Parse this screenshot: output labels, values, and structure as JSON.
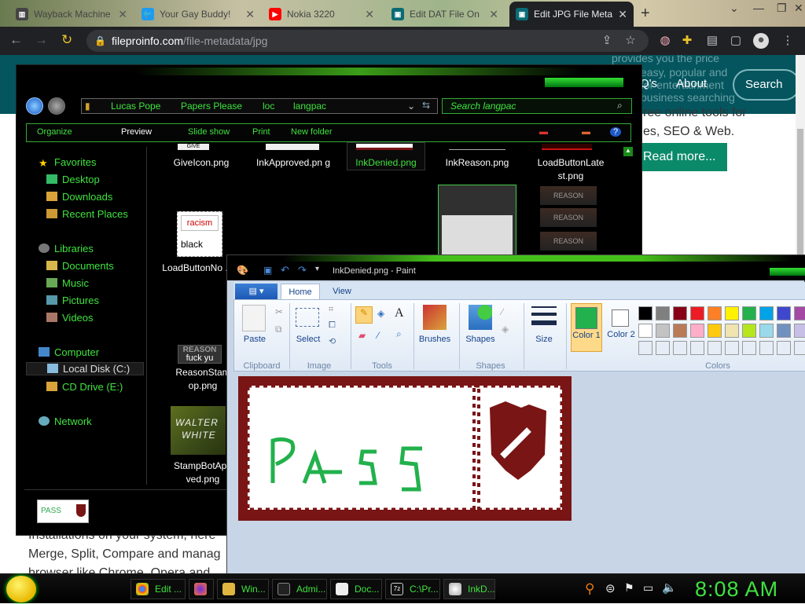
{
  "browser": {
    "tabs": [
      {
        "title": "Wayback Machine",
        "fav_color": "#555"
      },
      {
        "title": "Your Gay Buddy!",
        "fav_color": "#1d9bf0"
      },
      {
        "title": "Nokia 3220",
        "fav_color": "#ff0000"
      },
      {
        "title": "Edit DAT File On",
        "fav_color": "#0a6b75"
      },
      {
        "title": "Edit JPG File Meta",
        "fav_color": "#0a6b75"
      }
    ],
    "new_tab": "+",
    "url_domain": "fileproinfo.com",
    "url_path": "/file-metadata/jpg"
  },
  "website": {
    "nav_partial": "Q's",
    "about": "About",
    "search": "Search",
    "faint_text": [
      "provides you the price",
      "easy, popular and",
      "for entertainment",
      "business searching"
    ],
    "body_lines": [
      "ree online tools for",
      "es, SEO & Web."
    ],
    "read_more": "Read more...",
    "bottom_lines": [
      "Installations on your system, here",
      "Merge, Split, Compare and manag",
      "browser like Chrome, Opera and"
    ]
  },
  "explorer": {
    "breadcrumb": [
      "Lucas Pope",
      "Papers Please",
      "loc",
      "langpac"
    ],
    "search_placeholder": "Search langpac",
    "commands": [
      "Organize",
      "Preview",
      "Slide show",
      "Print",
      "New folder"
    ],
    "nav": {
      "favorites": "Favorites",
      "fav_items": [
        "Desktop",
        "Downloads",
        "Recent Places"
      ],
      "libraries": "Libraries",
      "lib_items": [
        "Documents",
        "Music",
        "Pictures",
        "Videos"
      ],
      "computer": "Computer",
      "comp_items": [
        "Local Disk (C:)",
        "CD Drive (E:)"
      ],
      "network": "Network"
    },
    "files": [
      {
        "name": "GiveIcon.png"
      },
      {
        "name": "InkApproved.pn g"
      },
      {
        "name": "InkDenied.png"
      },
      {
        "name": "InkReason.png"
      },
      {
        "name": "LoadButtonLate st.png"
      },
      {
        "name": "LoadButtonNo .png"
      },
      {
        "name": "ReasonStam op.png"
      },
      {
        "name": "StampBotApp ved.png"
      }
    ],
    "thumb_text": {
      "give_icon": "GIVE",
      "racism": "racism",
      "black": "black",
      "reason": "REASON",
      "fuck_yu": "fuck yu",
      "walter": "WALTER",
      "white": "WHITE",
      "pass": "PASS"
    }
  },
  "paint": {
    "title": "InkDenied.png - Paint",
    "tabs": [
      "Home",
      "View"
    ],
    "groups": [
      "Clipboard",
      "Image",
      "Tools",
      "Shapes",
      "Colors"
    ],
    "tools": {
      "paste": "Paste",
      "select": "Select",
      "brushes": "Brushes",
      "shapes": "Shapes",
      "size": "Size",
      "color1": "Color 1",
      "color2": "Color 2"
    },
    "color1": "#22b14c",
    "palette_row1": [
      "#000000",
      "#7f7f7f",
      "#880015",
      "#ed1c24",
      "#ff7f27",
      "#fff200",
      "#22b14c",
      "#00a2e8",
      "#3f48cc",
      "#a349a4"
    ],
    "palette_row2": [
      "#ffffff",
      "#c3c3c3",
      "#b97a57",
      "#ffaec9",
      "#ffc90e",
      "#efe4b0",
      "#b5e61d",
      "#99d9ea",
      "#7092be",
      "#c8bfe7"
    ]
  },
  "taskbar": {
    "items": [
      "Edit ...",
      "",
      "Win...",
      "Admi...",
      "Doc...",
      "C:\\Pr...",
      "InkD..."
    ],
    "clock": "8:08 AM"
  }
}
